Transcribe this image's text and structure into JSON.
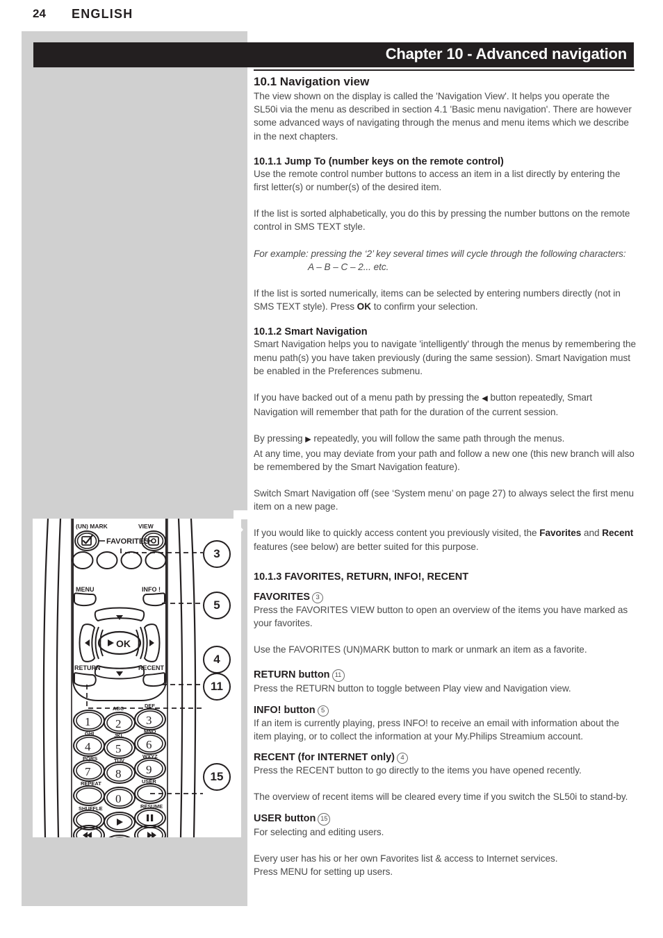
{
  "page": {
    "number": "24",
    "language": "ENGLISH"
  },
  "chapter": {
    "title": "Chapter 10 - Advanced navigation"
  },
  "sections": {
    "s101": {
      "heading": "10.1 Navigation view",
      "p1": "The view shown on the display is called the 'Navigation View'. It helps you operate the SL50i via the menu as described in section 4.1 'Basic menu navigation'. There are however some advanced ways of navigating through the menus and menu items which we describe in the next chapters."
    },
    "s1011": {
      "heading": "10.1.1 Jump To (number keys on the remote control)",
      "p1": "Use the remote control number buttons to access an item in a list directly by entering the first letter(s) or number(s) of the desired item.",
      "p2": "If the list is sorted alphabetically, you do this by pressing the number buttons on the remote control in SMS TEXT style.",
      "p3_italic": "For example: pressing the ‘2’ key several times will cycle through the following characters:",
      "p4_italic_indent": "A – B – C – 2... etc.",
      "p5_a": "If the list is sorted numerically, items can be selected by entering numbers directly (not in SMS TEXT style). Press ",
      "p5_bold": "OK",
      "p5_b": " to confirm your selection."
    },
    "s1012": {
      "heading": "10.1.2 Smart Navigation",
      "p1": "Smart Navigation helps you to navigate 'intelligently' through the menus by remembering the menu path(s) you have taken previously (during the same session). Smart Navigation must be enabled in the Preferences submenu.",
      "p2_a": "If you have backed out of a menu path by pressing the ",
      "p2_icon": "◀",
      "p2_b": " button repeatedly, Smart Navigation will remember that path for the duration of the current session.",
      "p3_a": "By pressing ",
      "p3_icon": "▶",
      "p3_b": " repeatedly, you will follow the same path through the menus.",
      "p4": "At any time, you may deviate from your path and follow a new one (this new branch will also be remembered by the Smart Navigation feature).",
      "p5": "Switch Smart Navigation off (see ‘System menu’ on page 27) to always select the first menu item on a new page.",
      "p6_a": "If you would like to quickly access content you previously visited, the ",
      "p6_bold1": "Favorites",
      "p6_mid": " and ",
      "p6_bold2": "Recent",
      "p6_b": " features (see below) are better suited for this purpose."
    },
    "s1013": {
      "heading": "10.1.3 FAVORITES, RETURN, INFO!, RECENT",
      "favorites": {
        "heading": "FAVORITES",
        "ref": "3",
        "p1": "Press the FAVORITES VIEW button to open an overview of the items you have marked as your favorites.",
        "p2": "Use the FAVORITES (UN)MARK button to mark or unmark an item as a favorite."
      },
      "return": {
        "heading": "RETURN button",
        "ref": "11",
        "p1": "Press the RETURN button to toggle between Play view and Navigation view."
      },
      "info": {
        "heading": "INFO! button",
        "ref": "5",
        "p1": "If an item is currently playing, press INFO! to receive an email with information about the item playing, or to collect the information at your My.Philips Streamium account."
      },
      "recent": {
        "heading": "RECENT (for INTERNET only)",
        "ref": "4",
        "p1": "Press the RECENT button to go directly to the items you have opened recently.",
        "p2": "The overview of recent items will be cleared every time if you switch the SL50i to stand-by."
      },
      "user": {
        "heading": "USER button",
        "ref": "15",
        "p1": "For selecting and editing users.",
        "p2": "Every user has his or her own Favorites list & access to Internet services.",
        "p3": "Press MENU for setting up users."
      }
    }
  },
  "remote": {
    "labels": {
      "unmark": "(UN) MARK",
      "view": "VIEW",
      "favorites": "FAVORITES",
      "menu": "MENU",
      "info": "INFO !",
      "ok": "OK",
      "return": "RETURN",
      "recent": "RECENT",
      "repeat": "REPEAT",
      "user": "USER",
      "shuffle": "SHUFFLE",
      "resume": "RESUME"
    },
    "keypad": [
      {
        "digit": "1",
        "letters": "_"
      },
      {
        "digit": "2",
        "letters": "ABC"
      },
      {
        "digit": "3",
        "letters": "DEF"
      },
      {
        "digit": "4",
        "letters": "GHI"
      },
      {
        "digit": "5",
        "letters": "JKL"
      },
      {
        "digit": "6",
        "letters": "MNO"
      },
      {
        "digit": "7",
        "letters": "PQRS"
      },
      {
        "digit": "8",
        "letters": "TUV"
      },
      {
        "digit": "9",
        "letters": "WXYZ"
      },
      {
        "digit": "0",
        "letters": "."
      }
    ],
    "callouts": [
      {
        "id": "3",
        "label": "3"
      },
      {
        "id": "5",
        "label": "5"
      },
      {
        "id": "4",
        "label": "4"
      },
      {
        "id": "11",
        "label": "11"
      },
      {
        "id": "15",
        "label": "15"
      }
    ]
  },
  "colors": {
    "panel_grey": "#d0d0d0",
    "bar_black": "#231f20",
    "body_text": "#4a4a4a",
    "heading_text": "#231f20"
  }
}
